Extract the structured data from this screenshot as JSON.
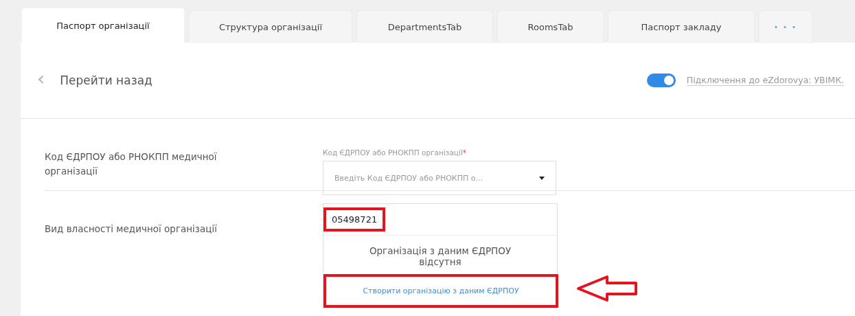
{
  "tabs": [
    {
      "label": "Паспорт організації",
      "selected": true
    },
    {
      "label": "Структура організації",
      "selected": false
    },
    {
      "label": "DepartmentsTab",
      "selected": false
    },
    {
      "label": "RoomsTab",
      "selected": false
    },
    {
      "label": "Паспорт закладу",
      "selected": false
    },
    {
      "label": "• • •",
      "selected": false
    }
  ],
  "back_link": {
    "icon": "‹",
    "label": "Перейти назад"
  },
  "ezdorovya_toggle": {
    "on": true,
    "label": "Підключення до eZdorovya: УВІМК."
  },
  "form": {
    "rows": [
      {
        "label": "Код ЄДРПОУ або РНОКПП медичної організації"
      },
      {
        "label": "Вид власності медичної організації"
      }
    ],
    "code_field": {
      "label": "Код ЄДРПОУ або РНОКПП організації",
      "required": true,
      "required_mark": "*",
      "placeholder": "Введіть Код ЄДРПОУ або РНОКПП о..."
    },
    "dropdown": {
      "search_value": "05498721",
      "search_annotated": true,
      "empty_message": "Організація з даним ЄДРПОУ відсутня",
      "create_option": "Створити організацію з даним ЄДРПОУ",
      "create_annotated": true,
      "arrow_annotation": true
    }
  }
}
